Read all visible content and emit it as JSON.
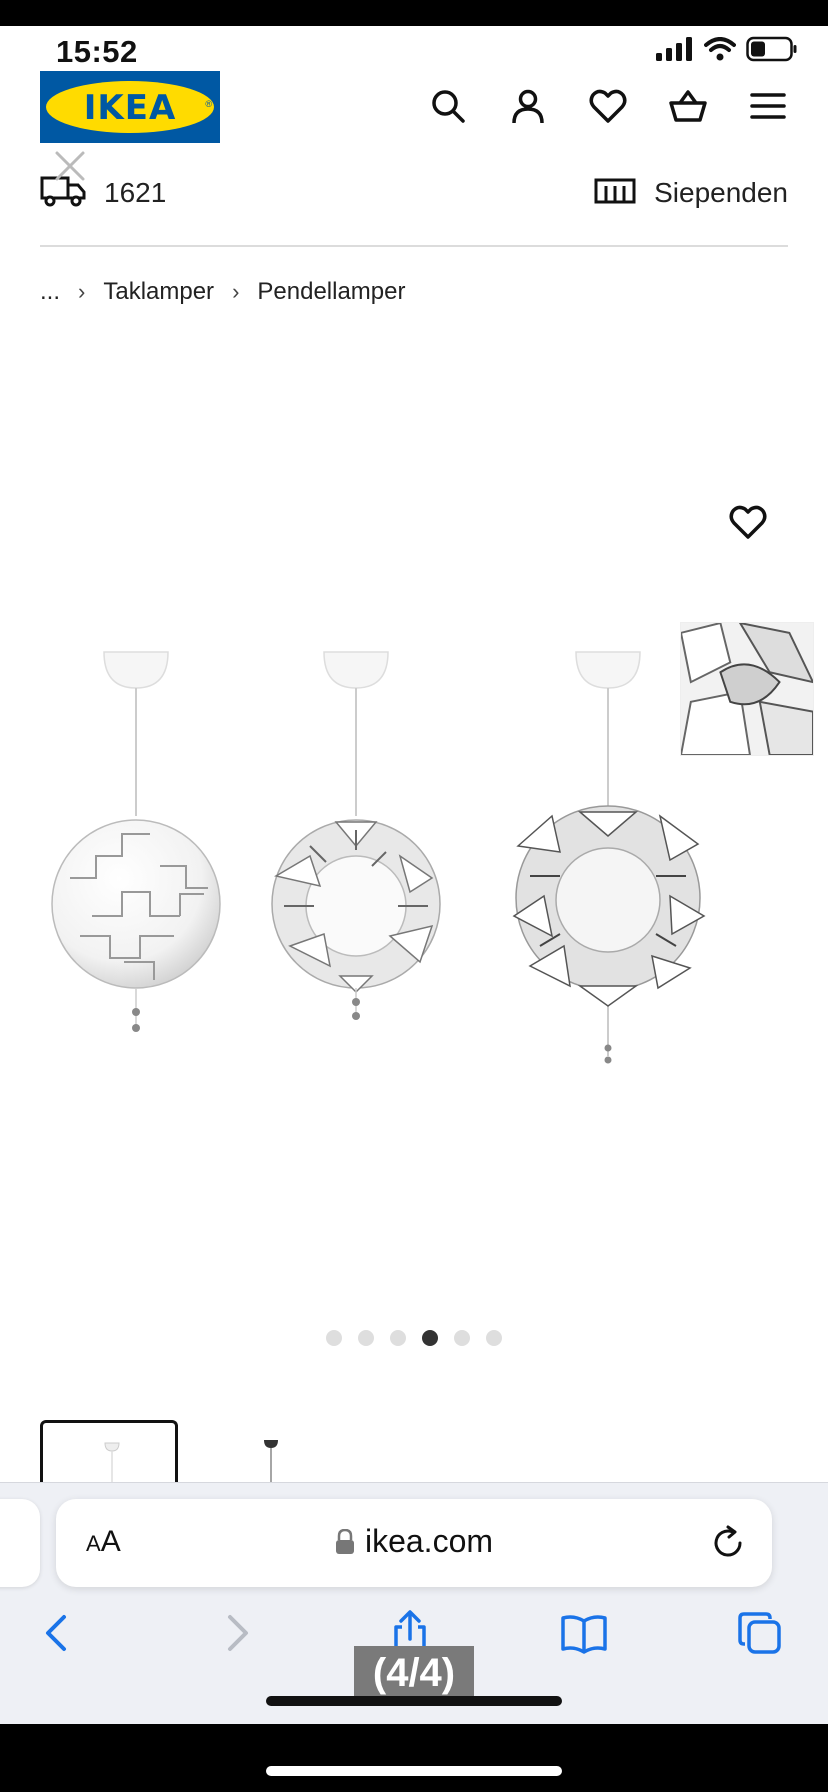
{
  "status_bar": {
    "time": "15:52"
  },
  "header": {
    "logo_text": "IKEA"
  },
  "info_row": {
    "left_text": "1621",
    "right_text": "Siependen"
  },
  "breadcrumb": {
    "ellipsis": "...",
    "items": [
      "Taklamper",
      "Pendellamper"
    ]
  },
  "carousel": {
    "total": 6,
    "active_index": 3
  },
  "browser": {
    "aa_label": "AA",
    "url": "ikea.com"
  },
  "caption": "(4/4)",
  "colors": {
    "ikea_blue": "#0058a3",
    "ikea_yellow": "#ffdb00",
    "safari_blue": "#1a73e8"
  },
  "icons": [
    "search-icon",
    "account-icon",
    "heart-icon",
    "basket-icon",
    "menu-icon",
    "truck-icon",
    "store-icon",
    "lock-icon",
    "reload-icon",
    "back-icon",
    "forward-icon",
    "share-icon",
    "bookmarks-icon",
    "tabs-icon"
  ]
}
